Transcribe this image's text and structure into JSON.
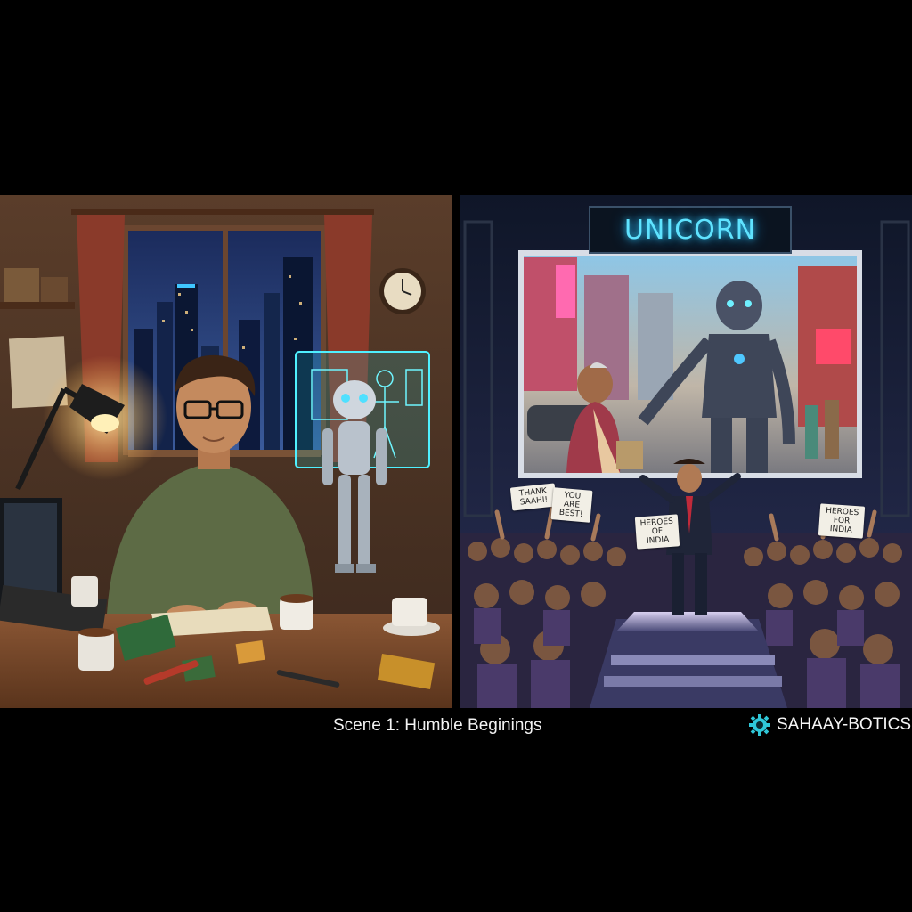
{
  "left_scene": {},
  "right_scene": {
    "header_sign": "UNICORN",
    "crowd_signs": [
      "THANK SAAHI!",
      "YOU ARE BEST!",
      "HEROES OF INDIA",
      "HEROES FOR INDIA"
    ]
  },
  "caption": "Scene 1: Humble Beginings",
  "brand": {
    "name": "SAHAAY-BOTICS",
    "icon": "gear-logo-icon",
    "color": "#2fc7d8"
  }
}
